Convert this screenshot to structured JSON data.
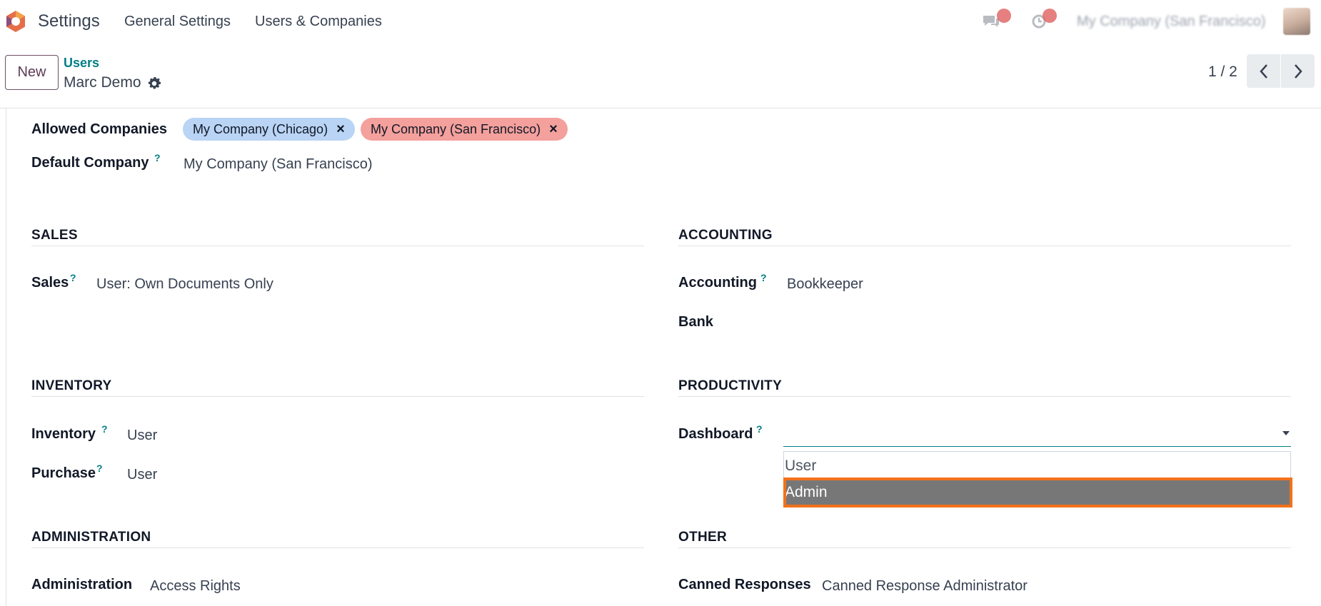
{
  "navbar": {
    "app_name": "Settings",
    "menu": [
      "General Settings",
      "Users & Companies"
    ],
    "company": "My Company (San Francisco)",
    "icons": [
      "chat-icon",
      "activity-clock-icon"
    ],
    "badge_color": "#e06060"
  },
  "control": {
    "new_label": "New",
    "breadcrumb_parent": "Users",
    "breadcrumb_current": "Marc Demo",
    "pager": "1 / 2"
  },
  "form": {
    "allowed_companies_label": "Allowed Companies",
    "allowed_companies": [
      {
        "name": "My Company (Chicago)",
        "color": "#b9d4f4"
      },
      {
        "name": "My Company (San Francisco)",
        "color": "#f4a09c"
      }
    ],
    "remove_glyph": "×",
    "default_company_label": "Default Company",
    "default_company_value": "My Company (San Francisco)",
    "help_glyph": "?"
  },
  "sections": {
    "sales": {
      "title": "SALES",
      "label": "Sales",
      "value": "User: Own Documents Only"
    },
    "accounting": {
      "title": "ACCOUNTING",
      "label": "Accounting",
      "value": "Bookkeeper",
      "bank_label": "Bank"
    },
    "inventory": {
      "title": "INVENTORY",
      "inventory_label": "Inventory",
      "inventory_value": "User",
      "purchase_label": "Purchase",
      "purchase_value": "User"
    },
    "productivity": {
      "title": "PRODUCTIVITY",
      "label": "Dashboard",
      "value": "",
      "options": [
        "User",
        "Admin"
      ],
      "highlighted": "Admin"
    },
    "administration": {
      "title": "ADMINISTRATION",
      "label": "Administration",
      "value": "Access Rights"
    },
    "other": {
      "title": "OTHER",
      "label": "Canned Responses",
      "value": "Canned Response Administrator"
    }
  },
  "colors": {
    "accent": "#017e84",
    "primary": "#714b67",
    "highlight_outline": "#f2711c"
  }
}
